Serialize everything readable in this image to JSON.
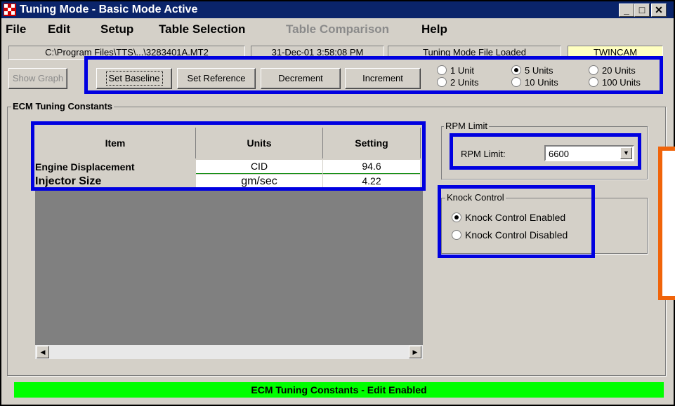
{
  "window": {
    "title": "Tuning Mode - Basic Mode Active",
    "minimize": "_",
    "maximize": "□",
    "close": "✕"
  },
  "menu": [
    "File",
    "Edit",
    "Setup",
    "Table Selection",
    "Table Comparison",
    "Help"
  ],
  "status_fields": {
    "file_path": "C:\\Program Files\\TTS\\...\\3283401A.MT2",
    "timestamp": "31-Dec-01 3:58:08 PM",
    "mode": "Tuning Mode File Loaded",
    "engine": "TWINCAM",
    "engine_bg": "#ffffc0"
  },
  "toolbar": {
    "show_graph": "Show Graph",
    "set_baseline": "Set Baseline",
    "set_reference": "Set Reference",
    "decrement": "Decrement",
    "increment": "Increment"
  },
  "units": {
    "options": [
      "1 Unit",
      "2 Units",
      "5 Units",
      "10 Units",
      "20 Units",
      "100 Units"
    ],
    "selected": "5 Units"
  },
  "ecm": {
    "group_title": "ECM Tuning Constants",
    "headers": {
      "item": "Item",
      "units": "Units",
      "setting": "Setting"
    },
    "rows": [
      {
        "item": "Engine Displacement",
        "units": "CID",
        "setting": "94.6"
      },
      {
        "item": "Injector Size",
        "units": "gm/sec",
        "setting": "4.22"
      }
    ]
  },
  "rpm": {
    "group_title": "RPM Limit",
    "label": "RPM Limit:",
    "value": "6600"
  },
  "knock": {
    "group_title": "Knock Control",
    "enabled_label": "Knock Control Enabled",
    "disabled_label": "Knock Control Disabled",
    "selected": "enabled"
  },
  "status_bar": {
    "text": "ECM Tuning Constants - Edit Enabled",
    "color": "#00ff00"
  },
  "highlight_colors": {
    "blue": "#0000e0",
    "orange": "#f0640a"
  }
}
